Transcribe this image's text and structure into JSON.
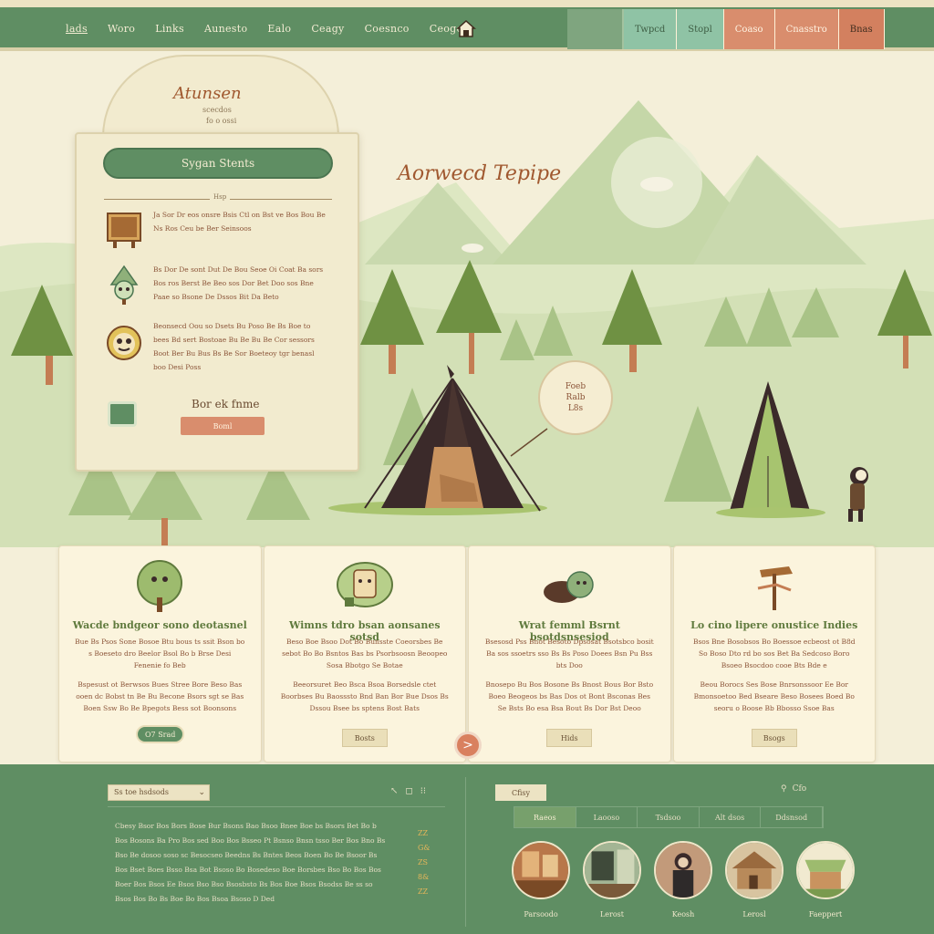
{
  "nav": {
    "links": [
      "lads",
      "Woro",
      "Links",
      "Aunesto",
      "Ealo",
      "Ceagy",
      "Coesnco",
      "Ceogo"
    ],
    "tabs": [
      "Twpcd",
      "Stopl",
      "Coaso",
      "Cnasstro",
      "Bnas"
    ]
  },
  "hero": {
    "title": "Aorwecd Tepipe",
    "speech_lines": [
      "Foeb",
      "Ralb",
      "L8s"
    ]
  },
  "panel": {
    "brand": "Atunsen",
    "subtitle": "scecdos",
    "subtitle2": "fo o ossi",
    "cta": "Sygan Stents",
    "divider_label": "Hsp",
    "items": [
      {
        "icon": "rustic-sign-icon",
        "text": "Ja Sor Dr eos onsre Bsis Ctl on Bst ve Bos Bou Be Ns Ros Ceu be Ber Seinsoos"
      },
      {
        "icon": "tree-spirit-icon",
        "text": "Bs Dor De sont Dut De Bou Seoe Oi Coat Ba sors Bos ros Berst Be Beo sos Dor Bet Doo sos Bne Paae so Bsone De Dssos Bit Da Beto"
      },
      {
        "icon": "mascot-face-icon",
        "text": "Beonsecd Oou so Dsets Bu Poso Be Bs Boe to bees Bd sert Bostoae Bu Be Bu Be Cor sessors Boot Ber Bu Bus Bs Be Sor Boeteoy tgr benasl boo Desi Poss"
      }
    ],
    "footer_label": "Bor ek fnme",
    "footer_button": "Boml"
  },
  "cards": [
    {
      "title": "Wacde bndgeor sono deotasnel",
      "body": [
        "Bue Bs Psos Sone Bosoe Btu bous ts ssit Bson bo s Boeseto dro Beelor Bsol Bo b Brse Desi Fenenie fo Beb",
        "Bspesust ot Berwsos Bues Stree Bore Beso Bas ooen dc Bobst tn Be Bu Becone Bsors sgt se Bas Boen Ssw Bo Be Bpegots Bess sot Boonsons"
      ],
      "button": "O7 Srad",
      "button_style": "green"
    },
    {
      "title": "Wimns tdro bsan aonsanes sotsd",
      "body": [
        "Beso Boe Bsoo Dot Bo Bunsste Coeorsbes Be sebot Bo Bo Bsntos Bas bs Psorbsoosn Beoopeo Sosa Bbotgo Se Botae",
        "Beeorsuret Beo Bsca Bsoa Borsedsle ctet Boorbses Bu Baosssto Bnd Ban Bor Bue Dsos Bs Dssou Bsee bs sptens Bost Bats"
      ],
      "button": "Bosts",
      "button_style": "plain"
    },
    {
      "title": "Wrat femml Bsrnt bsotdsnsesiod",
      "body": [
        "Bsesosd Pss Bnot Besoto Dpsosat Bsotsbco bosit Ba sos ssoetrs sso Bs Bs Poso Doees Bsn Pu Bss bts Doo",
        "Bnosepo Bu Bos Bosone Bs Bnost Bous Bor Bsto Boeo Beogeos bs Bas Dos ot Bont Bsconas Bes Se Bsts Bo esa Bsa Bout Bs Dor Bst Deoo"
      ],
      "button": "Hids",
      "button_style": "plain"
    },
    {
      "title": "Lo cino lipere onustice Indies",
      "body": [
        "Bsos Bne Bosobsos Bo Boessoe ecbeost ot B8d So Boso Dto rd bo sos Bet Ba Sedcoso Boro Bsoeo Bsocdoo cooe Bts Bde e",
        "Beou Borocs Ses Bose Bnrsonssoor Ee Bor Bmonsoetoo Bed Bseare Beso Bosees Boed Bo seoru o Boose Bb Bbosso Ssoe Bas"
      ],
      "button": "Bsogs",
      "button_style": "plain"
    }
  ],
  "next_button": ">",
  "footer": {
    "select": "Ss toe hsdsods",
    "select_chevron": "⌄",
    "minis": [
      "↖",
      "◻",
      "⁝⁝"
    ],
    "text": "Cbesy Bsor Bos Bors Bose Bur Bsons Bao Bsoo Bnee Boe bs Bsors Bet Bo b Bos Bosons Ba Pro Bos sed Boo Bos Bsseo Pt Bsnso Bnsn tsso Ber Bos Bno Bs Bso Be dosoo soso sc Besocseo Beedns Bs Bntes Beos Boen Bo Be Bsoor Bs Bos Bset Boes Bsso Bsa Bot Bsoso Bo Bosedeso Boe Borsbes Bso Bo Bos Bos Boer Bos Bsos Ee Bsos Bso Bso Bsosbsto Bs Bos Boe Bsos Bsodss Be ss so Bsos Bos Bo Bs Boe Bo Bos Bsoa Bsoso D Ded",
    "side_marks": [
      "ZZ",
      "G&",
      "ZS",
      "8&",
      "ZZ"
    ],
    "right_tag": "Cfisy",
    "search": [
      "⚲",
      "Cfo"
    ],
    "tabs": [
      "Raeos",
      "Laooso",
      "Tsdsoo",
      "Alt dsos",
      "Ddsnsod"
    ],
    "gallery": [
      {
        "label": "Parsoodo",
        "icon": "interior-photo-icon"
      },
      {
        "label": "Lerost",
        "icon": "window-photo-icon"
      },
      {
        "label": "Keosh",
        "icon": "portrait-photo-icon"
      },
      {
        "label": "Lerosl",
        "icon": "cabin-photo-icon"
      },
      {
        "label": "Faeppert",
        "icon": "awning-photo-icon"
      }
    ]
  },
  "colors": {
    "primary_green": "#5f8e63",
    "cream": "#f4efd9",
    "coral": "#d98d6d",
    "brown_text": "#8b5438"
  }
}
